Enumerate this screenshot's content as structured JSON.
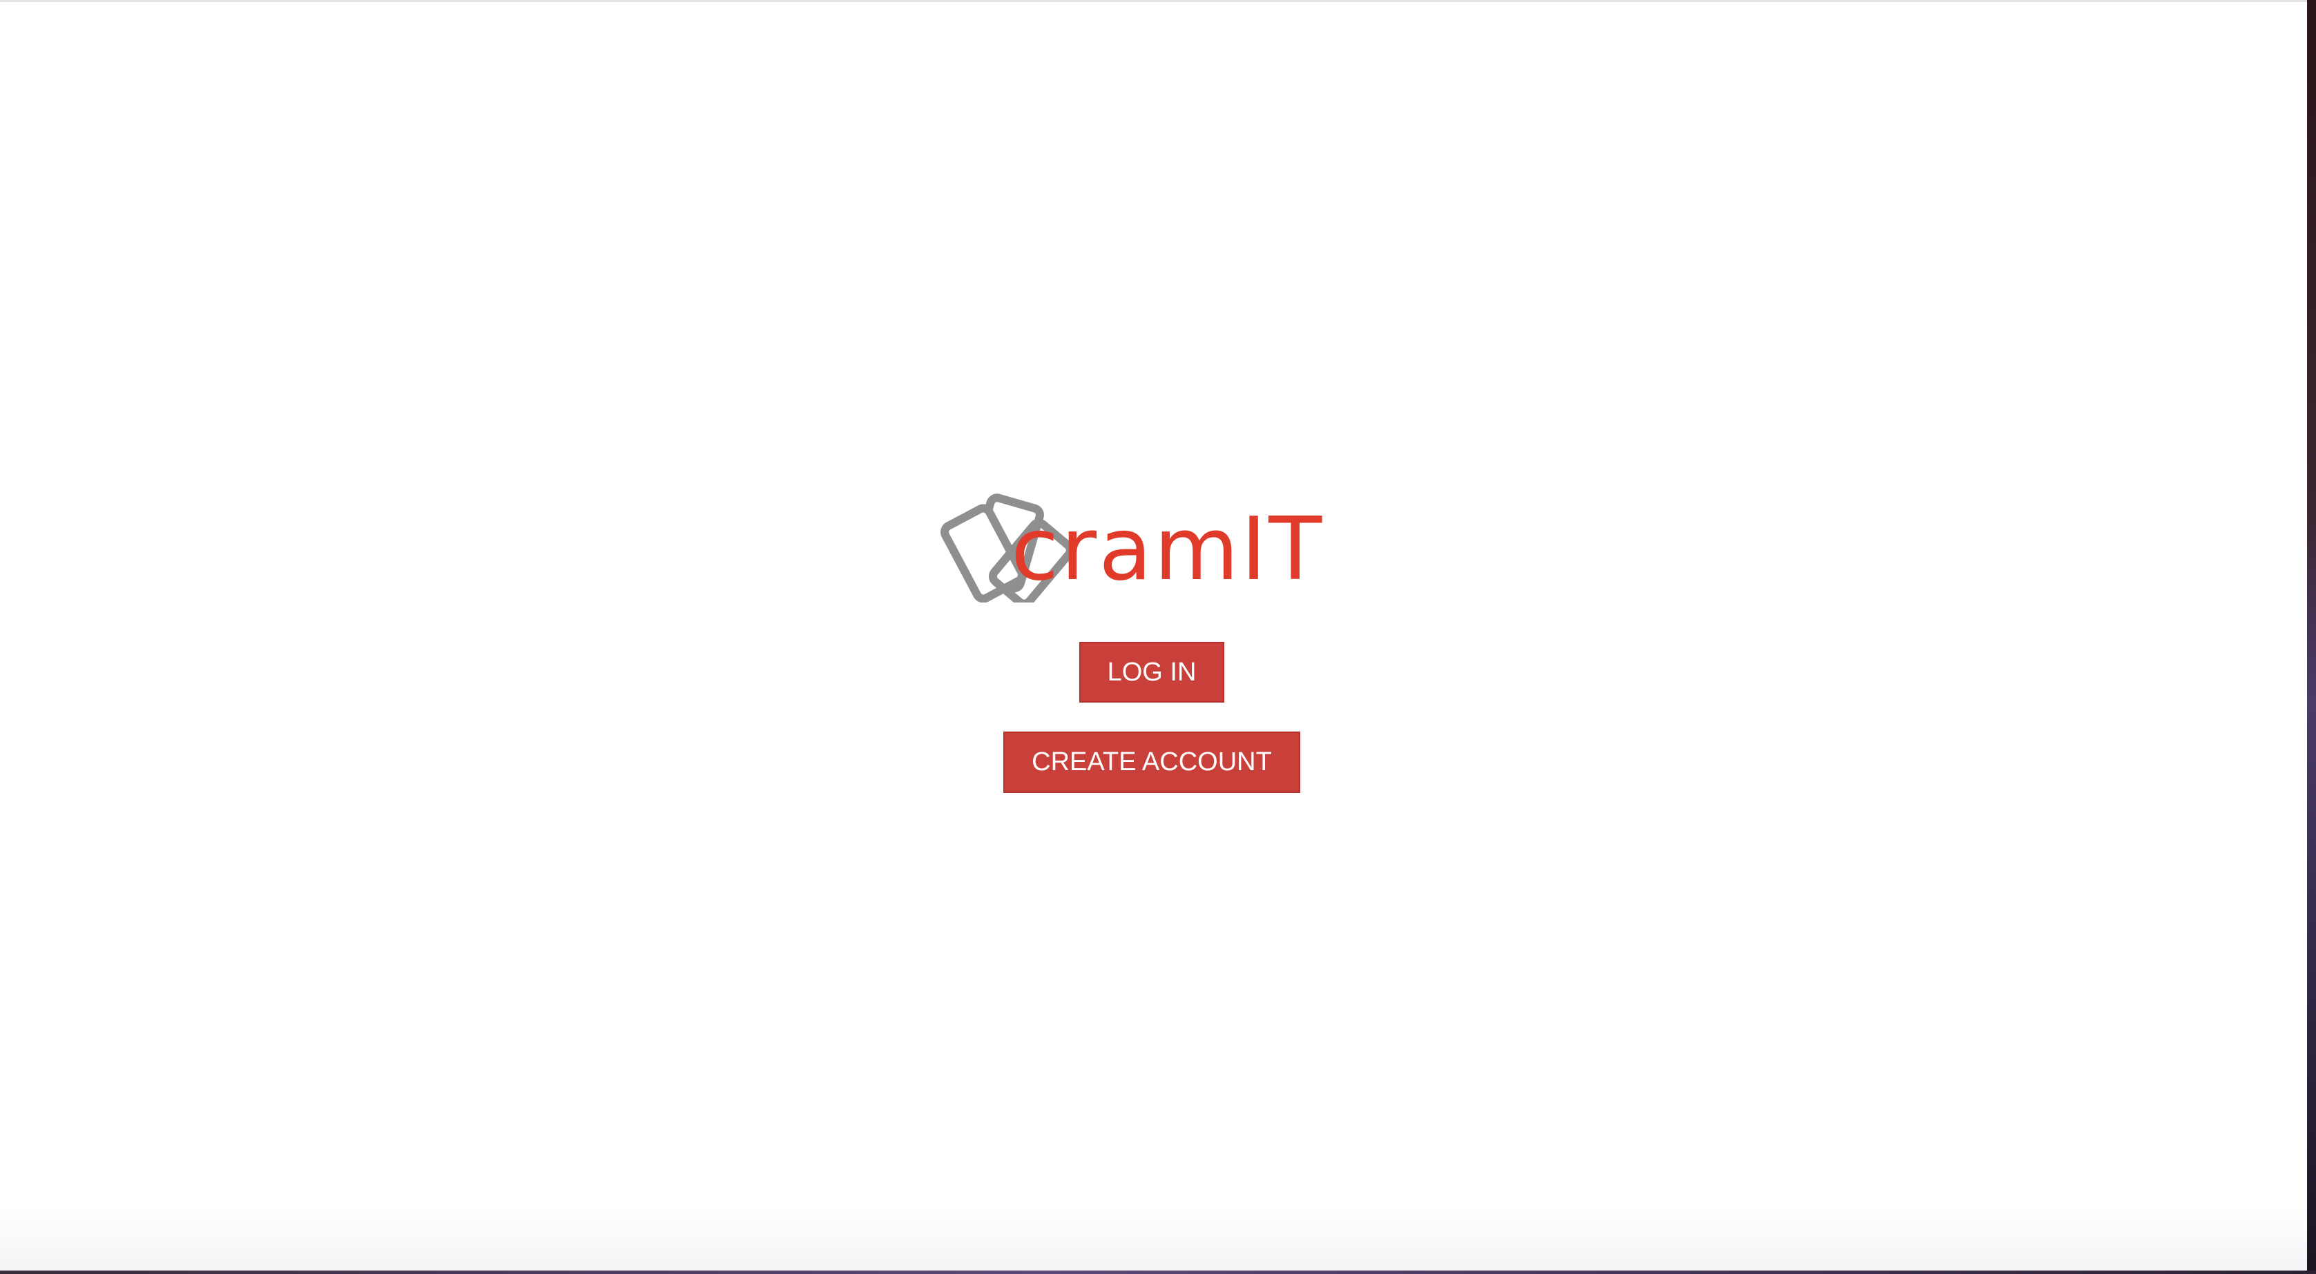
{
  "logo": {
    "text": "cramIT",
    "icon": "cards-icon",
    "colors": {
      "text": "#e03b2a",
      "icon": "#8f8f8f"
    }
  },
  "actions": {
    "login_label": "LOG IN",
    "create_account_label": "CREATE ACCOUNT"
  },
  "colors": {
    "button_bg": "#c9403b",
    "button_text": "#ffffff",
    "page_bg": "#ffffff"
  }
}
